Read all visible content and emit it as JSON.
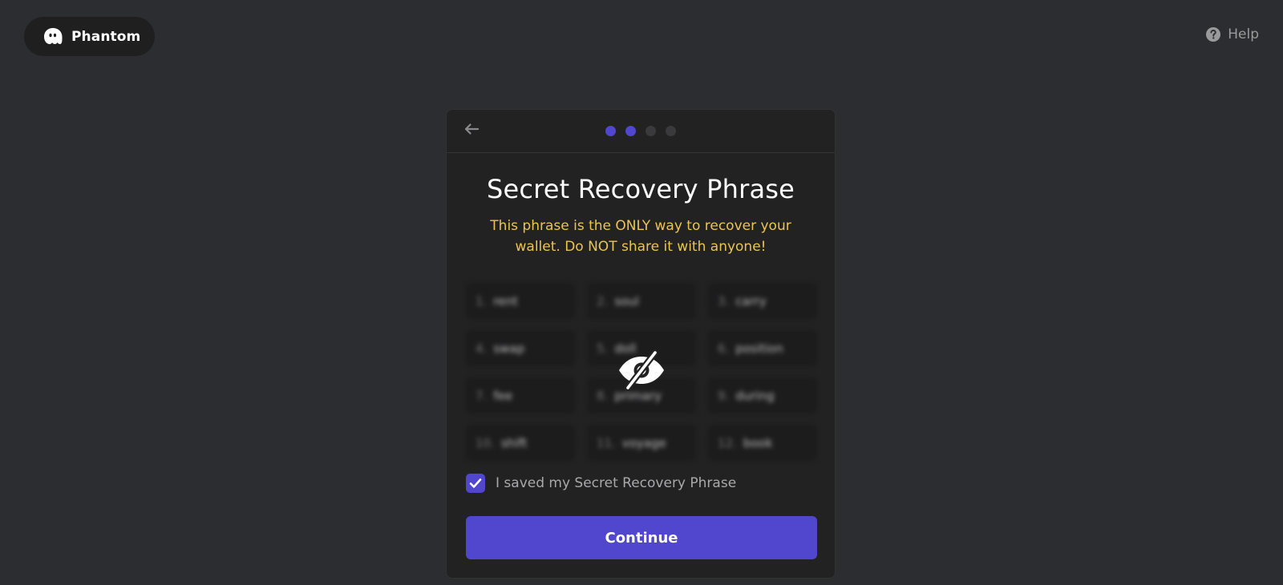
{
  "header": {
    "brand": "Phantom",
    "help_label": "Help"
  },
  "card": {
    "steps": {
      "total": 4,
      "completed": 2
    },
    "title": "Secret Recovery Phrase",
    "warning": "This phrase is the ONLY way to recover your wallet. Do NOT share it with anyone!",
    "phrase": [
      {
        "num": "1.",
        "word": "rent"
      },
      {
        "num": "2.",
        "word": "soul"
      },
      {
        "num": "3.",
        "word": "carry"
      },
      {
        "num": "4.",
        "word": "swap"
      },
      {
        "num": "5.",
        "word": "doll"
      },
      {
        "num": "6.",
        "word": "position"
      },
      {
        "num": "7.",
        "word": "fee"
      },
      {
        "num": "8.",
        "word": "primary"
      },
      {
        "num": "9.",
        "word": "during"
      },
      {
        "num": "10.",
        "word": "shift"
      },
      {
        "num": "11.",
        "word": "voyage"
      },
      {
        "num": "12.",
        "word": "book"
      }
    ],
    "checkbox_label": "I saved my Secret Recovery Phrase",
    "checkbox_checked": true,
    "continue_label": "Continue"
  },
  "colors": {
    "background": "#2c2d30",
    "card": "#222222",
    "accent": "#5146ce",
    "warning": "#ebc451",
    "muted": "#9a9a9d"
  },
  "icons": {
    "brand": "phantom-ghost-icon",
    "help": "help-circle-icon",
    "back": "arrow-left-icon",
    "reveal": "eye-off-icon",
    "check": "check-icon"
  }
}
